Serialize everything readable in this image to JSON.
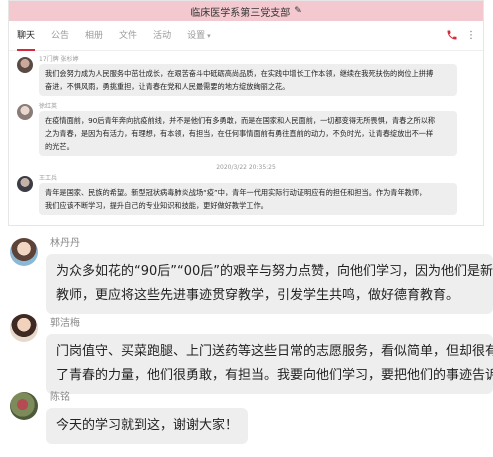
{
  "window": {
    "title": "临床医学系第三党支部",
    "title_icon": "edit-icon"
  },
  "tabs": [
    {
      "label": "聊天",
      "active": true
    },
    {
      "label": "公告"
    },
    {
      "label": "相册"
    },
    {
      "label": "文件"
    },
    {
      "label": "活动"
    },
    {
      "label": "设置"
    }
  ],
  "toolbar": {
    "phone_icon": "phone-icon",
    "more_icon": "more-icon"
  },
  "small_chat": {
    "messages": [
      {
        "name": "17门牌 张杉婷",
        "text_lines": [
          "我们会努力成为人民服务中茁壮成长，在艰苦奋斗中砥砺高尚品质，在实践中增长工作本领，继续在我死扶伤的岗位上拼搏",
          "奋进，不惧风雨，勇挑重担，让青春在党和人民最需要的地方绽放绚丽之花。"
        ]
      },
      {
        "name": "徐红英",
        "text_lines": [
          "在疫情面前，90后青年奔向抗疫前线，并不是他们有多勇敢，而是在国家和人民面前，一切都变得无所畏惧，青春之所以称",
          "之为青春，是因为有活力，有理想，有本领，有担当，在任何事情面前有勇往直前的动力，不负时光，让青春绽放出不一样",
          "的光芒。"
        ]
      },
      {
        "time": "2020/3/22 20:35:25"
      },
      {
        "name": "王工兵",
        "text_lines": [
          "青年是国家、民族的希望。新型冠状病毒肺炎战场“疫”中，青年一代用实际行动证明应有的担任和担当。作为青年教师，",
          "我们应该不断学习，提升自己的专业知识和技能，更好做好教学工作。"
        ]
      }
    ]
  },
  "big_chat": {
    "messages": [
      {
        "name": "林丹丹",
        "text_lines": [
          "为众多如花的“90后”“00后”的艰辛与努力点赞，向他们学习，因为他们是新时",
          "教师，更应将这些先进事迹贯穿教学，引发学生共鸣，做好德育教育。"
        ]
      },
      {
        "name": "郭洁梅",
        "text_lines": [
          "门岗值守、买菜跑腿、上门送药等这些日常的志愿服务，看似简单，但却很有温度",
          "了青春的力量，他们很勇敢，有担当。我要向他们学习，要把他们的事迹告诉我的"
        ]
      },
      {
        "name": "陈铭",
        "text_lines": [
          "今天的学习就到这，谢谢大家！"
        ]
      }
    ]
  }
}
